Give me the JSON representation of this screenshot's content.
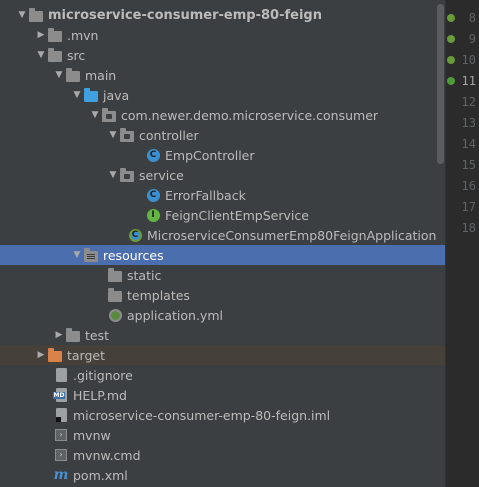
{
  "tree": {
    "rows": [
      {
        "label": "microservice-consumer-emp-80-feign",
        "arrow": "▼",
        "icon": "folder",
        "root": true
      },
      {
        "label": ".mvn",
        "arrow": "▶",
        "icon": "folder"
      },
      {
        "label": "src",
        "arrow": "▼",
        "icon": "folder"
      },
      {
        "label": "main",
        "arrow": "▼",
        "icon": "folder"
      },
      {
        "label": "java",
        "arrow": "▼",
        "icon": "folder-blue"
      },
      {
        "label": "com.newer.demo.microservice.consumer",
        "arrow": "▼",
        "icon": "package"
      },
      {
        "label": "controller",
        "arrow": "▼",
        "icon": "package"
      },
      {
        "label": "EmpController",
        "arrow": "",
        "icon": "class-icon"
      },
      {
        "label": "service",
        "arrow": "▼",
        "icon": "package"
      },
      {
        "label": "ErrorFallback",
        "arrow": "",
        "icon": "class-icon"
      },
      {
        "label": "FeignClientEmpService",
        "arrow": "",
        "icon": "interface-icon"
      },
      {
        "label": "MicroserviceConsumerEmp80FeignApplication",
        "arrow": "",
        "icon": "spring-boot-class-icon"
      },
      {
        "label": "resources",
        "arrow": "▼",
        "icon": "resources-folder",
        "selected": true
      },
      {
        "label": "static",
        "arrow": "",
        "icon": "folder"
      },
      {
        "label": "templates",
        "arrow": "",
        "icon": "folder"
      },
      {
        "label": "application.yml",
        "arrow": "",
        "icon": "spring-config-icon"
      },
      {
        "label": "test",
        "arrow": "▶",
        "icon": "folder"
      },
      {
        "label": "target",
        "arrow": "▶",
        "icon": "folder-orange",
        "excluded": true
      },
      {
        "label": ".gitignore",
        "arrow": "",
        "icon": "file"
      },
      {
        "label": "HELP.md",
        "arrow": "",
        "icon": "markdown-icon"
      },
      {
        "label": "microservice-consumer-emp-80-feign.iml",
        "arrow": "",
        "icon": "iml-icon"
      },
      {
        "label": "mvnw",
        "arrow": "",
        "icon": "terminal-icon"
      },
      {
        "label": "mvnw.cmd",
        "arrow": "",
        "icon": "terminal-icon"
      },
      {
        "label": "pom.xml",
        "arrow": "",
        "icon": "maven-icon"
      }
    ]
  },
  "gutter": {
    "lines": [
      "8",
      "9",
      "10",
      "11",
      "12",
      "13",
      "14",
      "15",
      "16",
      "17",
      "18"
    ],
    "current_line": "11"
  },
  "colors": {
    "background": "#3c3f41",
    "selection": "#4b6eaf",
    "excluded": "#45403a",
    "editor": "#2b2b2b"
  }
}
